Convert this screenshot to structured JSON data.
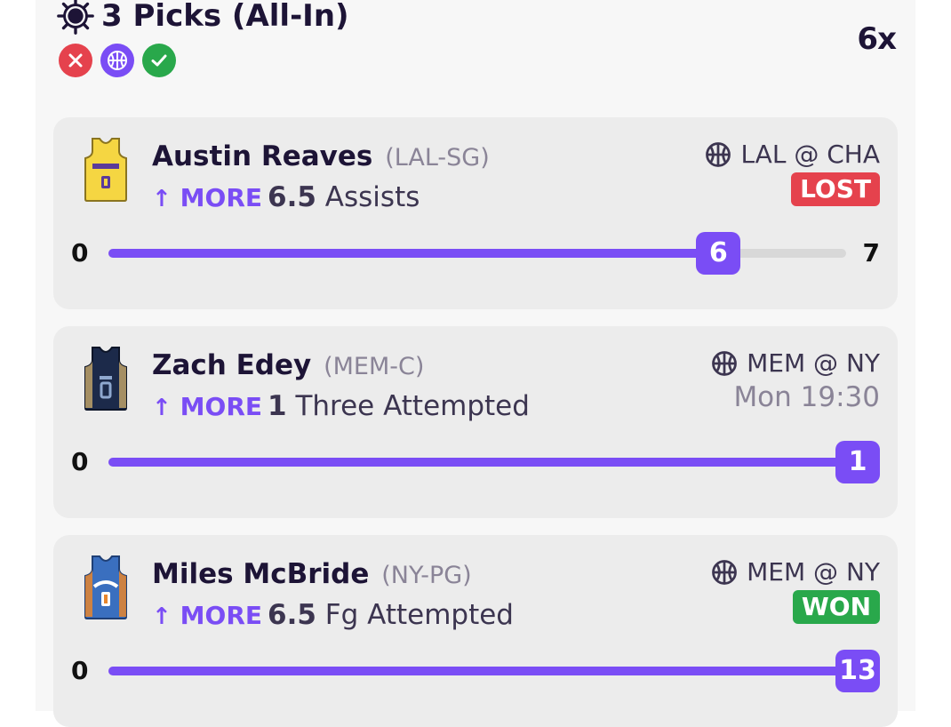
{
  "header": {
    "title": "3 Picks (All-In)",
    "multiplier": "6x",
    "status_icons": [
      "x-circle-icon",
      "basketball-icon",
      "check-circle-icon"
    ]
  },
  "colors": {
    "accent": "#7a4df5",
    "lost": "#e5424d",
    "won": "#29a84b",
    "text_dark": "#1d1436",
    "text_muted": "#8a8497"
  },
  "picks": [
    {
      "name": "Austin Reaves",
      "position": "(LAL-SG)",
      "direction": "MORE",
      "line": "6.5",
      "stat": "Assists",
      "matchup": "LAL @ CHA",
      "status": "LOST",
      "scale_min": "0",
      "scale_max": "7",
      "current": "6",
      "progress": 0.857
    },
    {
      "name": "Zach Edey",
      "position": "(MEM-C)",
      "direction": "MORE",
      "line": "1",
      "stat": "Three Attempted",
      "matchup": "MEM @ NY",
      "time": "Mon 19:30",
      "scale_min": "0",
      "current": "1",
      "progress": 1.0
    },
    {
      "name": "Miles McBride",
      "position": "(NY-PG)",
      "direction": "MORE",
      "line": "6.5",
      "stat": "Fg Attempted",
      "matchup": "MEM @ NY",
      "status": "WON",
      "scale_min": "0",
      "current": "13",
      "progress": 1.0
    }
  ]
}
